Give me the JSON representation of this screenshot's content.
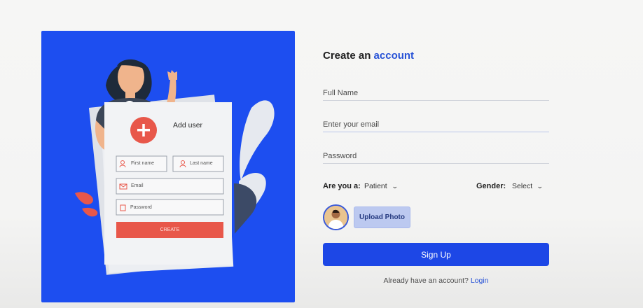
{
  "illustration": {
    "card_title": "Add user",
    "first_name": "First name",
    "last_name": "Last name",
    "email": "Email",
    "password": "Password",
    "create": "CREATE"
  },
  "form": {
    "title_prefix": "Create an",
    "title_accent": "account",
    "full_name_placeholder": "Full Name",
    "email_placeholder": "Enter your email",
    "password_placeholder": "Password",
    "role_label": "Are you a:",
    "role_value": "Patient",
    "gender_label": "Gender:",
    "gender_value": "Select",
    "upload_label": "Upload Photo",
    "signup_label": "Sign Up",
    "login_prompt": "Already have an account?",
    "login_link": "Login"
  },
  "colors": {
    "accent": "#2752d6",
    "hero_bg": "#1d4ef0",
    "button_bg": "#1d47e6",
    "upload_bg": "#bcc9f0",
    "create_button": "#e8574a"
  },
  "icons": [
    "plus-icon",
    "user-icon",
    "mail-icon",
    "lock-icon",
    "chevron-down-icon"
  ]
}
